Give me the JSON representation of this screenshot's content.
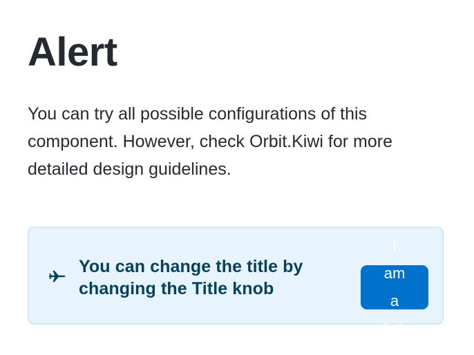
{
  "page": {
    "title": "Alert",
    "description": "You can try all possible configurations of this component. However, check Orbit.Kiwi for more detailed design guidelines."
  },
  "alert": {
    "icon": "airplane-icon",
    "title": "You can change the title by changing the Title knob",
    "action_label": "I am a link"
  },
  "colors": {
    "alert_background": "#e8f4fd",
    "alert_border": "#d0e8fb",
    "alert_text": "#07405c",
    "button_background": "#0172cb",
    "button_text": "#ffffff",
    "page_text": "#252a31"
  }
}
